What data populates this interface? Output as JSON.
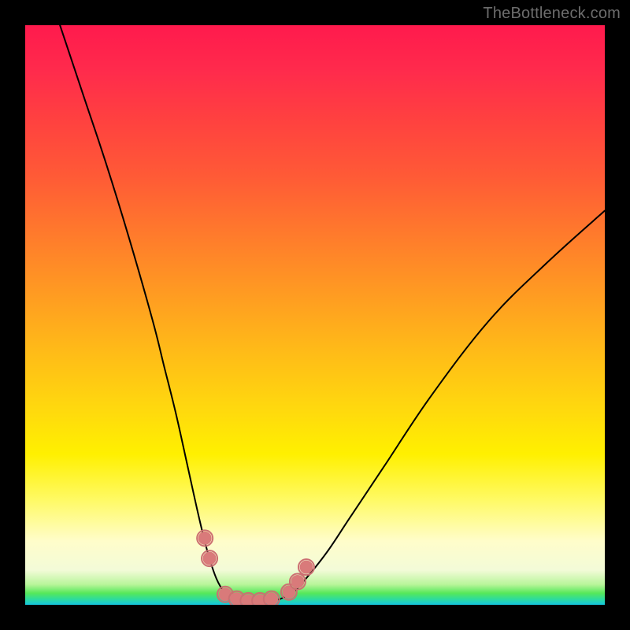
{
  "watermark": "TheBottleneck.com",
  "chart_data": {
    "type": "line",
    "title": "",
    "xlabel": "",
    "ylabel": "",
    "xlim": [
      0,
      100
    ],
    "ylim": [
      0,
      100
    ],
    "grid": false,
    "legend": false,
    "series": [
      {
        "name": "left-curve",
        "x": [
          6,
          10,
          14,
          18,
          22,
          24,
          26,
          28,
          30,
          31.5,
          33,
          34.5,
          36
        ],
        "values": [
          100,
          88,
          76,
          63,
          49,
          41,
          33,
          24,
          15,
          9,
          4.5,
          2,
          1
        ]
      },
      {
        "name": "right-curve",
        "x": [
          44,
          46,
          48,
          52,
          56,
          62,
          70,
          80,
          90,
          100
        ],
        "values": [
          1,
          2,
          4,
          9,
          15,
          24,
          36,
          49,
          59,
          68
        ]
      },
      {
        "name": "valley-floor",
        "x": [
          36,
          38,
          40,
          42,
          44
        ],
        "values": [
          1,
          0.6,
          0.5,
          0.6,
          1
        ]
      }
    ],
    "markers": [
      {
        "name": "left-dot-1",
        "x": 31.0,
        "y": 11.5
      },
      {
        "name": "left-dot-2",
        "x": 31.8,
        "y": 8.0
      },
      {
        "name": "valley-dot-1",
        "x": 34.5,
        "y": 1.8
      },
      {
        "name": "valley-dot-2",
        "x": 36.5,
        "y": 1.0
      },
      {
        "name": "valley-dot-3",
        "x": 38.5,
        "y": 0.7
      },
      {
        "name": "valley-dot-4",
        "x": 40.5,
        "y": 0.7
      },
      {
        "name": "valley-dot-5",
        "x": 42.5,
        "y": 1.0
      },
      {
        "name": "right-dot-1",
        "x": 45.5,
        "y": 2.2
      },
      {
        "name": "right-dot-2",
        "x": 47.0,
        "y": 4.0
      },
      {
        "name": "right-dot-3",
        "x": 48.5,
        "y": 6.5
      }
    ]
  }
}
